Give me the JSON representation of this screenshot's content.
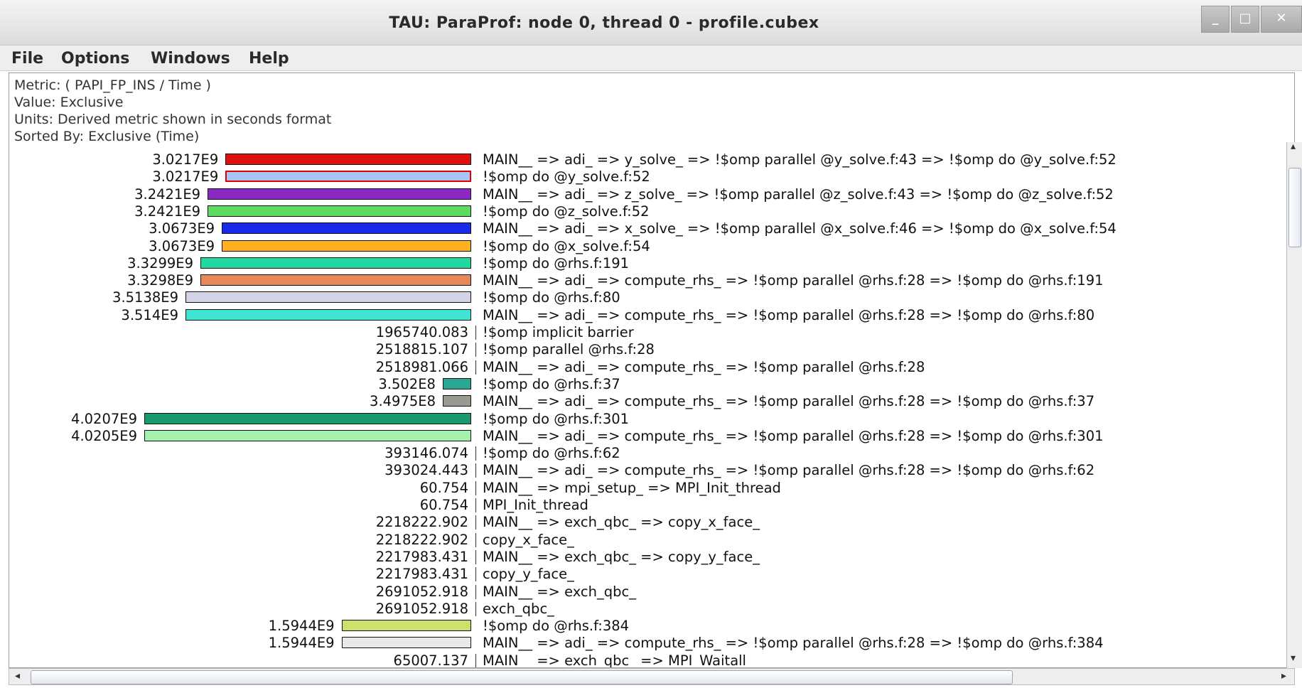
{
  "window": {
    "title": "TAU: ParaProf: node 0, thread 0 - profile.cubex",
    "minimize_glyph": "_",
    "maximize_glyph": "□",
    "close_glyph": "✕"
  },
  "menu": [
    "File",
    "Options",
    "Windows",
    "Help"
  ],
  "header": {
    "metric": "Metric: ( PAPI_FP_INS / Time )",
    "value": "Value: Exclusive",
    "units": "Units: Derived metric shown in seconds format",
    "sorted": "Sorted By: Exclusive (Time)"
  },
  "colors": {
    "selected_outline": "#e00000"
  },
  "rows": [
    {
      "value": "3.0217E9",
      "value_num": 3021700000.0,
      "color": "#e01010",
      "name": "MAIN__ => adi_ => y_solve_ => !$omp parallel @y_solve.f:43 => !$omp do @y_solve.f:52"
    },
    {
      "value": "3.0217E9",
      "value_num": 3021700000.0,
      "color": "#a7c6f5",
      "selected": true,
      "name": "!$omp do @y_solve.f:52"
    },
    {
      "value": "3.2421E9",
      "value_num": 3242100000.0,
      "color": "#8a28c4",
      "name": "MAIN__ => adi_ => z_solve_ => !$omp parallel @z_solve.f:43 => !$omp do @z_solve.f:52"
    },
    {
      "value": "3.2421E9",
      "value_num": 3242100000.0,
      "color": "#5edc60",
      "name": "!$omp do @z_solve.f:52"
    },
    {
      "value": "3.0673E9",
      "value_num": 3067300000.0,
      "color": "#1a2ae8",
      "name": "MAIN__ => adi_ => x_solve_ => !$omp parallel @x_solve.f:46 => !$omp do @x_solve.f:54"
    },
    {
      "value": "3.0673E9",
      "value_num": 3067300000.0,
      "color": "#ffb020",
      "name": "!$omp do @x_solve.f:54"
    },
    {
      "value": "3.3299E9",
      "value_num": 3329900000.0,
      "color": "#20d8a0",
      "name": "!$omp do @rhs.f:191"
    },
    {
      "value": "3.3298E9",
      "value_num": 3329800000.0,
      "color": "#e8875a",
      "name": "MAIN__ => adi_ => compute_rhs_ => !$omp parallel @rhs.f:28 => !$omp do @rhs.f:191"
    },
    {
      "value": "3.5138E9",
      "value_num": 3513800000.0,
      "color": "#d4d4e8",
      "name": "!$omp do @rhs.f:80"
    },
    {
      "value": "3.514E9",
      "value_num": 3514000000.0,
      "color": "#40e4d2",
      "name": "MAIN__ => adi_ => compute_rhs_ => !$omp parallel @rhs.f:28 => !$omp do @rhs.f:80"
    },
    {
      "value": "1965740.083",
      "value_num": 1965740.083,
      "name": "!$omp implicit barrier"
    },
    {
      "value": "2518815.107",
      "value_num": 2518815.107,
      "name": "!$omp parallel @rhs.f:28"
    },
    {
      "value": "2518981.066",
      "value_num": 2518981.066,
      "name": "MAIN__ => adi_ => compute_rhs_ => !$omp parallel @rhs.f:28"
    },
    {
      "value": "3.502E8",
      "value_num": 350200000.0,
      "color": "#2aa894",
      "name": "!$omp do @rhs.f:37"
    },
    {
      "value": "3.4975E8",
      "value_num": 349750000.0,
      "color": "#9a9a92",
      "name": "MAIN__ => adi_ => compute_rhs_ => !$omp parallel @rhs.f:28 => !$omp do @rhs.f:37"
    },
    {
      "value": "4.0207E9",
      "value_num": 4020700000.0,
      "color": "#1a9a6c",
      "name": "!$omp do @rhs.f:301"
    },
    {
      "value": "4.0205E9",
      "value_num": 4020500000.0,
      "color": "#a8f0b0",
      "name": "MAIN__ => adi_ => compute_rhs_ => !$omp parallel @rhs.f:28 => !$omp do @rhs.f:301"
    },
    {
      "value": "393146.074",
      "value_num": 393146.074,
      "name": "!$omp do @rhs.f:62"
    },
    {
      "value": "393024.443",
      "value_num": 393024.443,
      "name": "MAIN__ => adi_ => compute_rhs_ => !$omp parallel @rhs.f:28 => !$omp do @rhs.f:62"
    },
    {
      "value": "60.754",
      "value_num": 60.754,
      "name": "MAIN__ => mpi_setup_ => MPI_Init_thread"
    },
    {
      "value": "60.754",
      "value_num": 60.754,
      "name": "MPI_Init_thread"
    },
    {
      "value": "2218222.902",
      "value_num": 2218222.902,
      "name": "MAIN__ => exch_qbc_ => copy_x_face_"
    },
    {
      "value": "2218222.902",
      "value_num": 2218222.902,
      "name": "copy_x_face_"
    },
    {
      "value": "2217983.431",
      "value_num": 2217983.431,
      "name": "MAIN__ => exch_qbc_ => copy_y_face_"
    },
    {
      "value": "2217983.431",
      "value_num": 2217983.431,
      "name": "copy_y_face_"
    },
    {
      "value": "2691052.918",
      "value_num": 2691052.918,
      "name": "MAIN__ => exch_qbc_"
    },
    {
      "value": "2691052.918",
      "value_num": 2691052.918,
      "name": "exch_qbc_"
    },
    {
      "value": "1.5944E9",
      "value_num": 1594400000.0,
      "color": "#cfe06a",
      "name": "!$omp do @rhs.f:384"
    },
    {
      "value": "1.5944E9",
      "value_num": 1594400000.0,
      "color": "#e8e8e8",
      "name": "MAIN__ => adi_ => compute_rhs_ => !$omp parallel @rhs.f:28 => !$omp do @rhs.f:384"
    },
    {
      "value": "65007.137",
      "value_num": 65007.137,
      "name": "MAIN__ => exch_qbc_ => MPI_Waitall"
    }
  ]
}
